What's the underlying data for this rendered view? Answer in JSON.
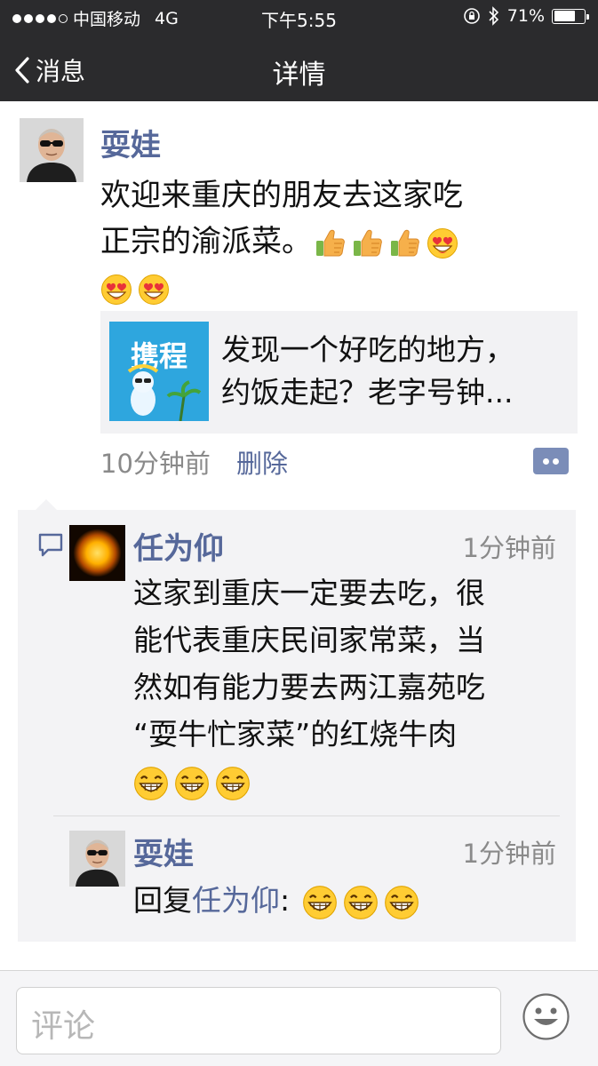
{
  "status_bar": {
    "carrier": "中国移动",
    "network": "4G",
    "time": "下午5:55",
    "battery": "71%",
    "battery_level": 0.71
  },
  "nav": {
    "back_label": "消息",
    "title": "详情"
  },
  "post": {
    "author": "耍娃",
    "text_line1": "欢迎来重庆的朋友去这家吃",
    "text_line2": "正宗的渝派菜。",
    "emojis_line2": [
      "thumbs-up",
      "thumbs-up",
      "thumbs-up",
      "heart-eyes"
    ],
    "emojis_line3": [
      "heart-eyes",
      "heart-eyes"
    ],
    "link_card": {
      "thumb_label": "携程",
      "line1": "发现一个好吃的地方，",
      "line2": "约饭走起？老字号钟..."
    },
    "time": "10分钟前",
    "delete_label": "删除"
  },
  "comments": [
    {
      "author": "任为仰",
      "time": "1分钟前",
      "lines": [
        "这家到重庆一定要去吃，很",
        "能代表重庆民间家常菜，当",
        "然如有能力要去两江嘉苑吃",
        "“耍牛忙家菜”的红烧牛肉"
      ],
      "emojis": [
        "grin",
        "grin",
        "grin"
      ]
    },
    {
      "author": "耍娃",
      "time": "1分钟前",
      "reply_prefix": "回复",
      "reply_to": "任为仰",
      "reply_colon": ":",
      "emojis": [
        "grin",
        "grin",
        "grin"
      ]
    }
  ],
  "input": {
    "placeholder": "评论"
  },
  "colors": {
    "bar": "#2b2b2d",
    "link_blue": "#56689a",
    "meta_gray": "#8a8a8a",
    "comment_bg": "#f3f3f5"
  }
}
